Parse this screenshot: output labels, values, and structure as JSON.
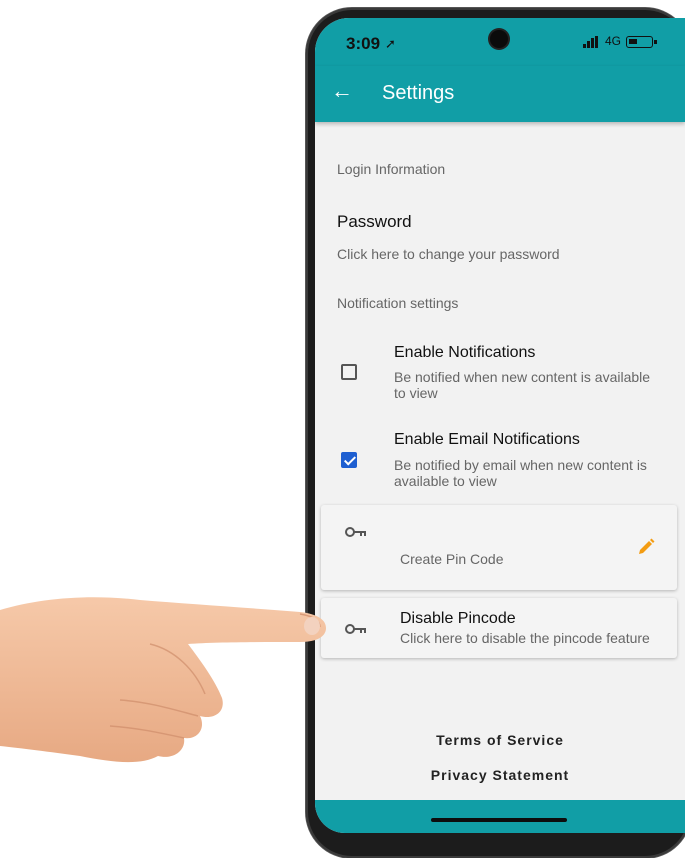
{
  "status_bar": {
    "time": "3:09",
    "network": "4G"
  },
  "app_bar": {
    "title": "Settings",
    "back_icon": "arrow-left-icon"
  },
  "sections": {
    "login": "Login Information",
    "notifications": "Notification settings"
  },
  "password": {
    "title": "Password",
    "subtitle": "Click here to change your password"
  },
  "options": [
    {
      "title": "Enable Notifications",
      "description": "Be notified when new content is available to view",
      "checked": false
    },
    {
      "title": "Enable Email Notifications",
      "description": "Be notified by email when new content is available to view",
      "checked": true
    }
  ],
  "pin_cards": {
    "create": {
      "title": "",
      "subtitle": "Create Pin Code"
    },
    "disable": {
      "title": "Disable Pincode",
      "subtitle": "Click here to disable the pincode feature"
    }
  },
  "footer": {
    "terms": "Terms of Service",
    "privacy": "Privacy Statement"
  },
  "colors": {
    "primary": "#119ea6",
    "checkbox": "#1e5fd1",
    "pencil": "#f39c12"
  }
}
